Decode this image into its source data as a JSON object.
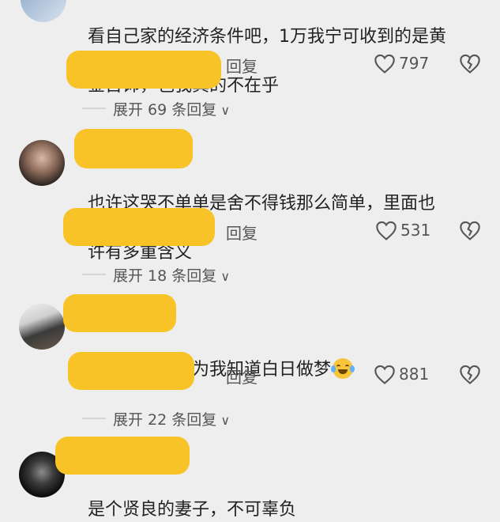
{
  "comments": [
    {
      "text_line1": "看自己家的经济条件吧，1万我宁可收到的是黄",
      "text_line2": "金首饰，包我真的不在乎",
      "reply_label": "回复",
      "likes": "797",
      "expand_label": "展开 69 条回复"
    },
    {
      "text_line1": "也许这哭不单单是舍不得钱那么简单，里面也",
      "text_line2": "许有多重含义",
      "reply_label": "回复",
      "likes": "531",
      "expand_label": "展开 18 条回复"
    },
    {
      "text_line1": "我没想过，因为我知道白日做梦",
      "reply_label": "回复",
      "likes": "881",
      "expand_label": "展开 22 条回复"
    },
    {
      "text_line1": "是个贤良的妻子，不可辜负"
    }
  ],
  "icons": {
    "like": "heart-outline-icon",
    "dislike": "broken-heart-icon",
    "expand": "chevron-down-icon",
    "emoji": "crying-laughing-emoji"
  },
  "colors": {
    "background": "#efeeee",
    "redaction": "#f7c327",
    "text": "#222222",
    "secondary": "#555555"
  }
}
